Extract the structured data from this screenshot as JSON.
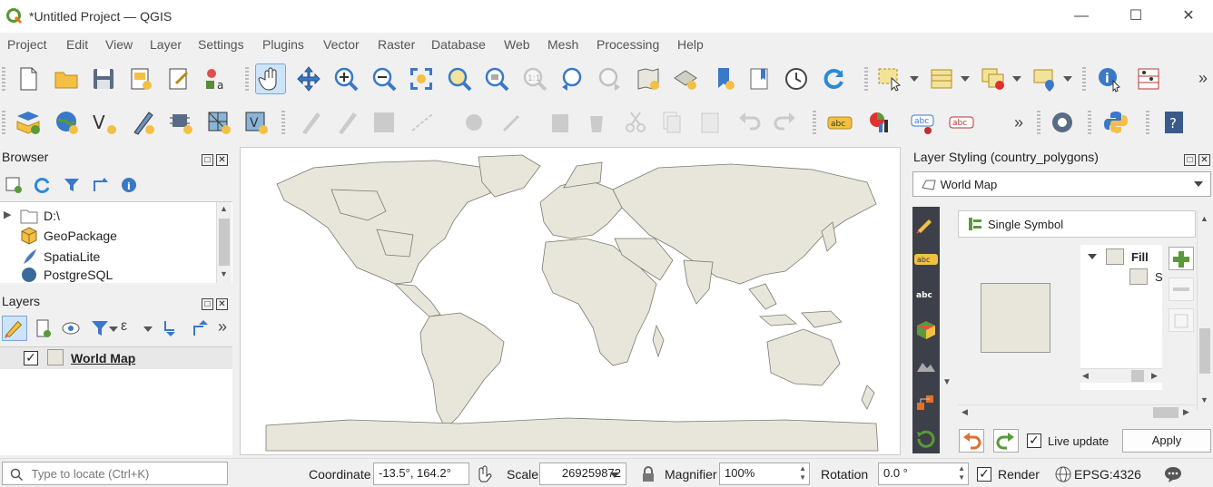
{
  "window": {
    "title": "*Untitled Project — QGIS"
  },
  "menu": [
    "Project",
    "Edit",
    "View",
    "Layer",
    "Settings",
    "Plugins",
    "Vector",
    "Raster",
    "Database",
    "Web",
    "Mesh",
    "Processing",
    "Help"
  ],
  "browser": {
    "title": "Browser",
    "items": [
      "D:\\",
      "GeoPackage",
      "SpatiaLite",
      "PostgreSQL"
    ]
  },
  "layers": {
    "title": "Layers",
    "items": [
      {
        "name": "World Map",
        "checked": true
      }
    ]
  },
  "styling": {
    "title": "Layer Styling (country_polygons)",
    "layer_select": "World Map",
    "renderer": "Single Symbol",
    "symbol_tree": {
      "fill": "Fill",
      "sub": "S"
    },
    "live_update_label": "Live update",
    "live_update": true,
    "apply_label": "Apply",
    "icon_labels": {
      "abc": "abc"
    }
  },
  "status": {
    "locate_placeholder": "Type to locate (Ctrl+K)",
    "coordinate_label": "Coordinate",
    "coordinate_value": "-13.5°, 164.2°",
    "scale_label": "Scale",
    "scale_value": "269259872",
    "magnifier_label": "Magnifier",
    "magnifier_value": "100%",
    "rotation_label": "Rotation",
    "rotation_value": "0.0 °",
    "render_label": "Render",
    "render_checked": true,
    "crs": "EPSG:4326"
  },
  "colors": {
    "land": "#e8e6da",
    "border": "#7a7a6e",
    "accent": "#1a73c8"
  }
}
